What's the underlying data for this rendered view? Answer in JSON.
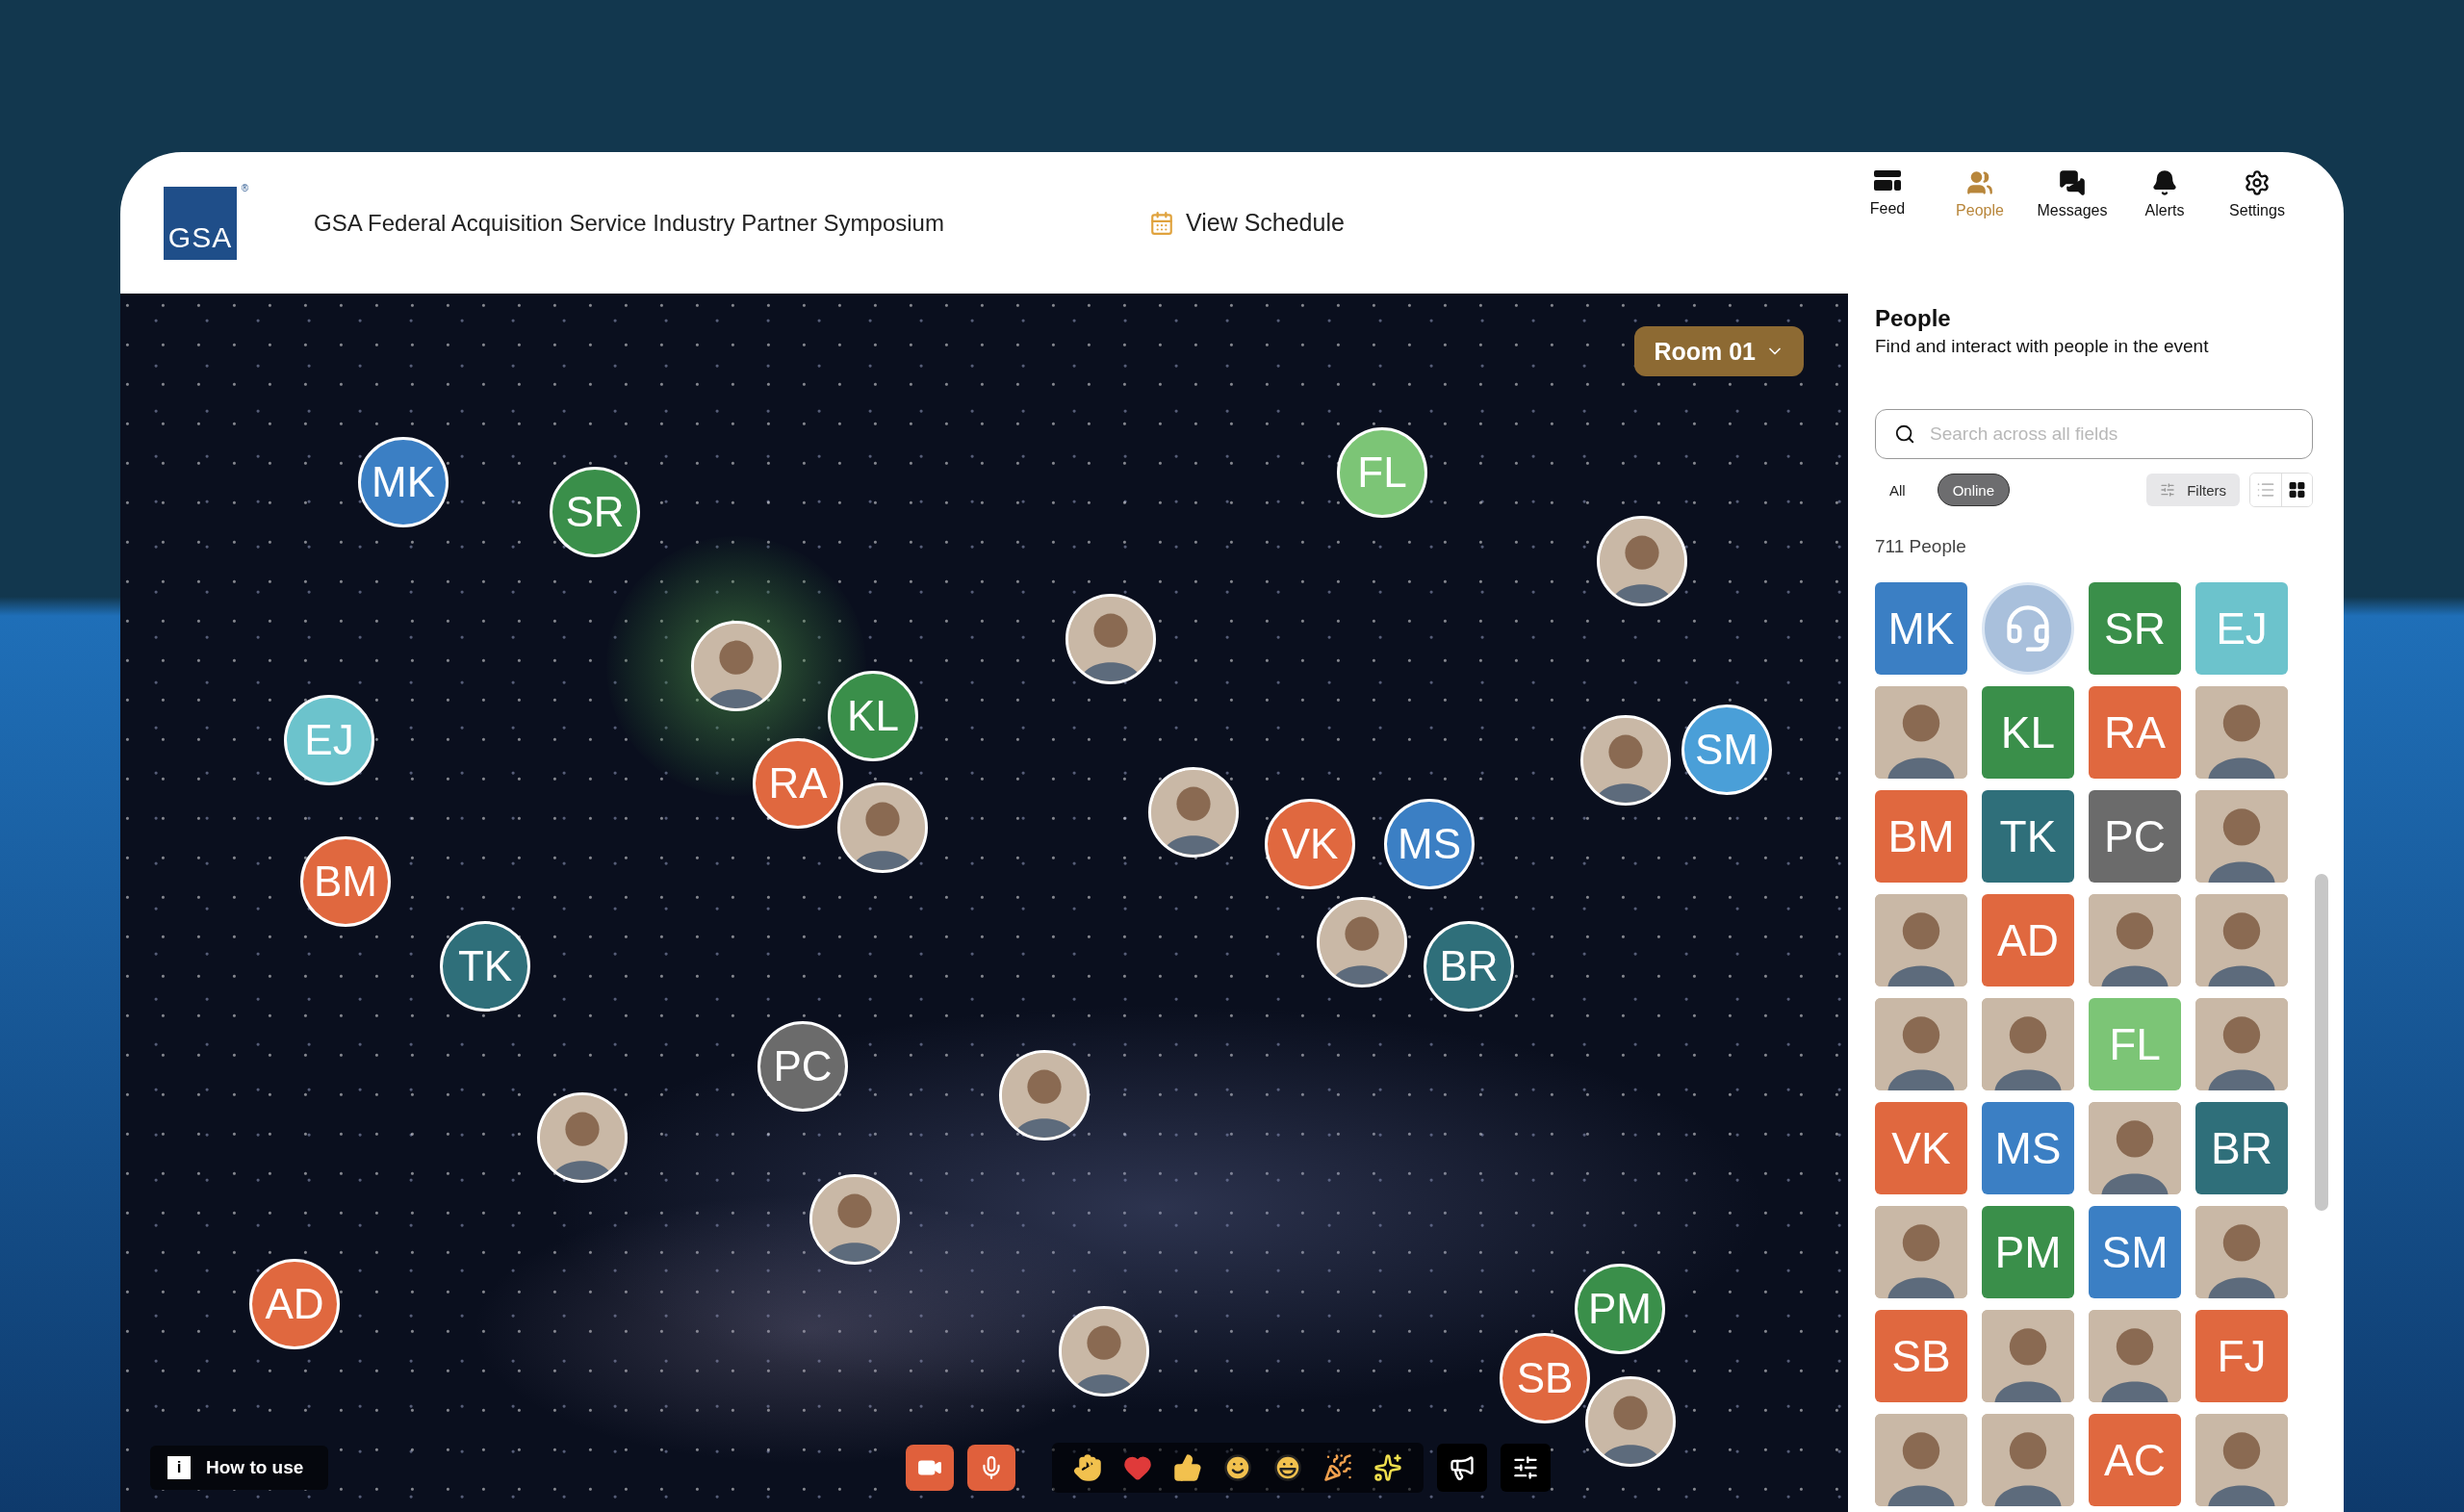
{
  "header": {
    "logo": {
      "text": "GSA",
      "mark": "®"
    },
    "title": "GSA Federal Acquisition Service Industry Partner Symposium",
    "schedule_link": "View Schedule",
    "nav": [
      {
        "kind": "feed",
        "label": "Feed",
        "selected": false
      },
      {
        "kind": "people",
        "label": "People",
        "selected": true
      },
      {
        "kind": "messages",
        "label": "Messages",
        "selected": false
      },
      {
        "kind": "alerts",
        "label": "Alerts",
        "selected": false
      },
      {
        "kind": "settings",
        "label": "Settings",
        "selected": false
      }
    ]
  },
  "room": {
    "button": "Room 01"
  },
  "canvas_avatars": [
    {
      "kind": "initials",
      "initials": "MK",
      "color": "#3b7fc4"
    },
    {
      "kind": "initials",
      "initials": "SR",
      "color": "#3a8f4a"
    },
    {
      "kind": "photo",
      "highlighted": true
    },
    {
      "kind": "initials",
      "initials": "KL",
      "color": "#3a8f4a"
    },
    {
      "kind": "initials",
      "initials": "EJ",
      "color": "#6cc3cc"
    },
    {
      "kind": "initials",
      "initials": "RA",
      "color": "#e0683f"
    },
    {
      "kind": "photo",
      "highlighted": false
    },
    {
      "kind": "photo",
      "highlighted": false
    },
    {
      "kind": "initials",
      "initials": "FL",
      "color": "#7cc576"
    },
    {
      "kind": "photo",
      "highlighted": false
    },
    {
      "kind": "photo",
      "highlighted": false
    },
    {
      "kind": "initials",
      "initials": "SM",
      "color": "#4a9fd8"
    },
    {
      "kind": "photo",
      "highlighted": false
    },
    {
      "kind": "initials",
      "initials": "VK",
      "color": "#e0683f"
    },
    {
      "kind": "initials",
      "initials": "MS",
      "color": "#3b7fc4"
    },
    {
      "kind": "photo",
      "highlighted": false
    },
    {
      "kind": "initials",
      "initials": "BR",
      "color": "#2f6f7a"
    },
    {
      "kind": "initials",
      "initials": "BM",
      "color": "#e0683f"
    },
    {
      "kind": "initials",
      "initials": "TK",
      "color": "#2f6f7a"
    },
    {
      "kind": "initials",
      "initials": "PC",
      "color": "#6b6b6b"
    },
    {
      "kind": "photo",
      "highlighted": false
    },
    {
      "kind": "photo",
      "highlighted": false
    },
    {
      "kind": "photo",
      "highlighted": false
    },
    {
      "kind": "initials",
      "initials": "AD",
      "color": "#e0683f"
    },
    {
      "kind": "photo",
      "highlighted": false
    },
    {
      "kind": "initials",
      "initials": "PM",
      "color": "#3a8f4a"
    },
    {
      "kind": "initials",
      "initials": "SB",
      "color": "#e0683f"
    },
    {
      "kind": "photo",
      "highlighted": false
    }
  ],
  "toolbar": {
    "help_button": {
      "glyph": "i",
      "label": "How to use"
    }
  },
  "panel": {
    "title": "People",
    "subtitle": "Find and interact with people in the event",
    "search": {
      "placeholder": "Search across all fields"
    },
    "filters": [
      {
        "label": "All",
        "selected": false
      },
      {
        "label": "Online",
        "selected": true
      }
    ],
    "filters_button": "Filters",
    "views": [
      {
        "kind": "list",
        "selected": false
      },
      {
        "kind": "grid",
        "selected": true
      }
    ],
    "count": "711 People",
    "people": [
      {
        "kind": "initials",
        "initials": "MK",
        "color": "#3b7fc4"
      },
      {
        "kind": "icon"
      },
      {
        "kind": "initials",
        "initials": "SR",
        "color": "#3a8f4a"
      },
      {
        "kind": "initials",
        "initials": "EJ",
        "color": "#6cc3cc"
      },
      {
        "kind": "photo"
      },
      {
        "kind": "initials",
        "initials": "KL",
        "color": "#3a8f4a"
      },
      {
        "kind": "initials",
        "initials": "RA",
        "color": "#e0683f"
      },
      {
        "kind": "photo"
      },
      {
        "kind": "initials",
        "initials": "BM",
        "color": "#e0683f"
      },
      {
        "kind": "initials",
        "initials": "TK",
        "color": "#2f6f7a"
      },
      {
        "kind": "initials",
        "initials": "PC",
        "color": "#6b6b6b"
      },
      {
        "kind": "photo"
      },
      {
        "kind": "photo"
      },
      {
        "kind": "initials",
        "initials": "AD",
        "color": "#e0683f"
      },
      {
        "kind": "photo"
      },
      {
        "kind": "photo"
      },
      {
        "kind": "photo"
      },
      {
        "kind": "photo"
      },
      {
        "kind": "initials",
        "initials": "FL",
        "color": "#7cc576"
      },
      {
        "kind": "photo"
      },
      {
        "kind": "initials",
        "initials": "VK",
        "color": "#e0683f"
      },
      {
        "kind": "initials",
        "initials": "MS",
        "color": "#3b7fc4"
      },
      {
        "kind": "photo"
      },
      {
        "kind": "initials",
        "initials": "BR",
        "color": "#2f6f7a"
      },
      {
        "kind": "photo"
      },
      {
        "kind": "initials",
        "initials": "PM",
        "color": "#3a8f4a"
      },
      {
        "kind": "initials",
        "initials": "SM",
        "color": "#3b7fc4"
      },
      {
        "kind": "photo"
      },
      {
        "kind": "initials",
        "initials": "SB",
        "color": "#e0683f"
      },
      {
        "kind": "photo"
      },
      {
        "kind": "photo"
      },
      {
        "kind": "initials",
        "initials": "FJ",
        "color": "#e0683f"
      },
      {
        "kind": "photo"
      },
      {
        "kind": "photo"
      },
      {
        "kind": "initials",
        "initials": "AC",
        "color": "#e0683f"
      },
      {
        "kind": "photo"
      }
    ]
  }
}
